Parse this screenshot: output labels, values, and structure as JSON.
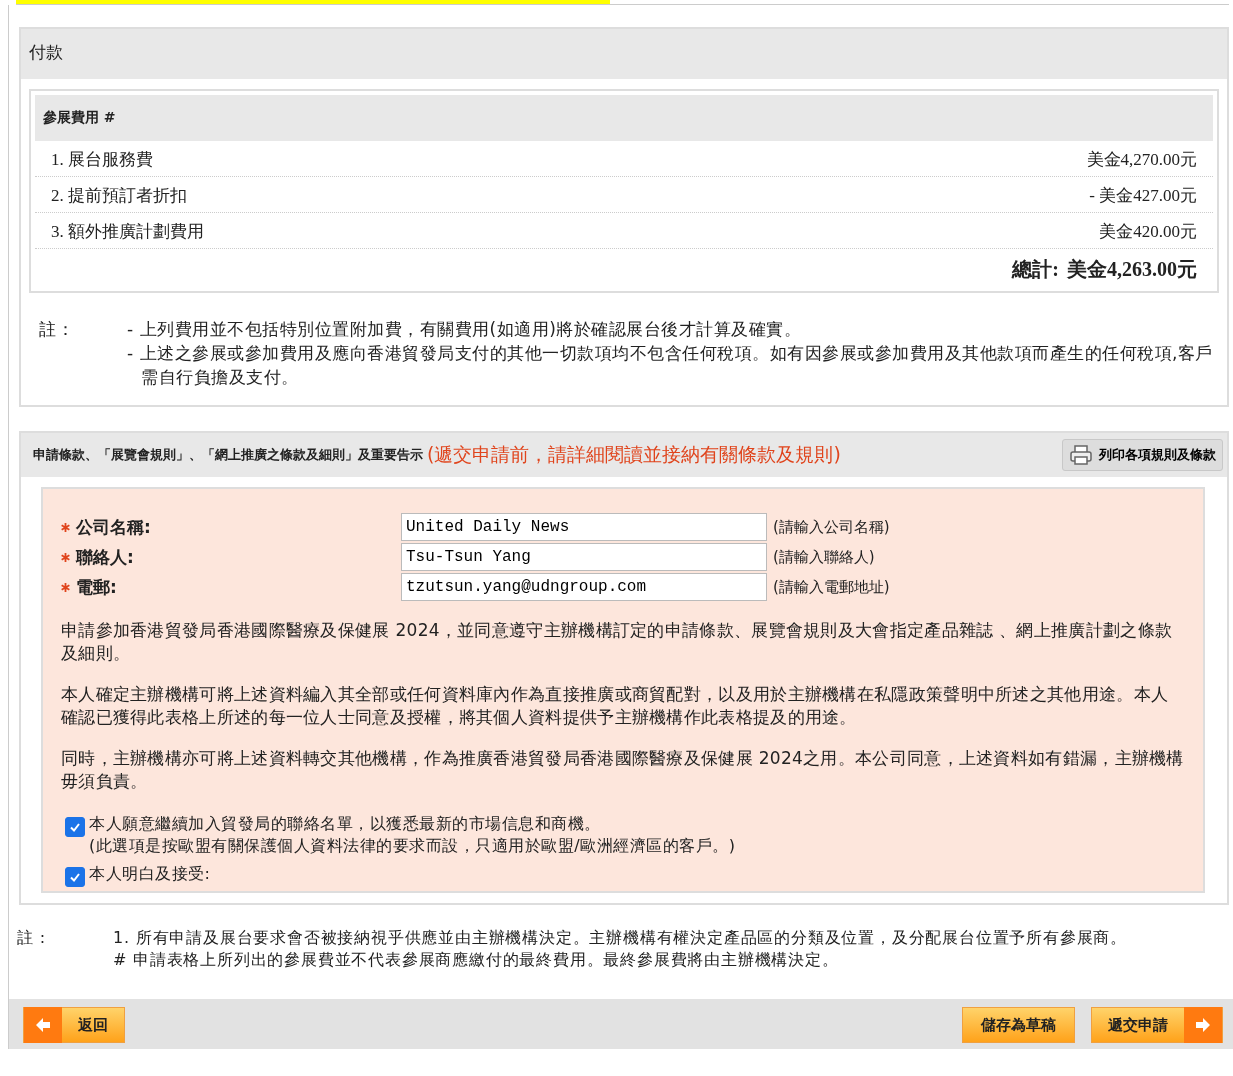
{
  "progress_bar": {
    "level": 0.49
  },
  "payment": {
    "title": "付款",
    "fees": {
      "heading": "參展費用 #",
      "items": [
        {
          "label": "1. 展台服務費",
          "amount": "美金4,270.00元"
        },
        {
          "label": "2. 提前預訂者折扣",
          "amount": "- 美金427.00元"
        },
        {
          "label": "3. 額外推廣計劃費用",
          "amount": "美金420.00元"
        }
      ],
      "total_label": "總計:",
      "total": "美金4,263.00元"
    },
    "note_label": "註：",
    "notes": [
      "- 上列費用並不包括特別位置附加費，有關費用(如適用)將於確認展台後才計算及確實。",
      "- 上述之參展或參加費用及應向香港貿發局支付的其他一切款項均不包含任何稅項。如有因參展或參加費用及其他款項而產生的任何稅項,客戶需自行負擔及支付。"
    ]
  },
  "terms": {
    "heading": "申請條款、「展覽會規則」、「網上推廣之條款及細則」及重要告示",
    "warning": "(遞交申請前，請詳細閱讀並接納有關條款及規則)",
    "print_button": "列印各項規則及條款",
    "fields": [
      {
        "label": "公司名稱:",
        "required": true,
        "value": "United Daily News",
        "hint": "(請輸入公司名稱)"
      },
      {
        "label": "聯絡人:",
        "required": true,
        "value": "Tsu-Tsun Yang",
        "hint": "(請輸入聯絡人)"
      },
      {
        "label": "電郵:",
        "required": true,
        "value": "tzutsun.yang@udngroup.com",
        "hint": "(請輸入電郵地址)"
      }
    ],
    "paragraphs": [
      "申請參加香港貿發局香港國際醫療及保健展 2024，並同意遵守主辦機構訂定的申請條款、展覽會規則及大會指定產品雜誌 、網上推廣計劃之條款及細則。",
      "本人確定主辦機構可將上述資料編入其全部或任何資料庫內作為直接推廣或商貿配對，以及用於主辦機構在私隱政策聲明中所述之其他用途。本人確認已獲得此表格上所述的每一位人士同意及授權，將其個人資料提供予主辦機構作此表格提及的用途。",
      "同時，主辦機構亦可將上述資料轉交其他機構，作為推廣香港貿發局香港國際醫療及保健展 2024之用。本公司同意，上述資料如有錯漏，主辦機構毋須負責。"
    ],
    "checkboxes": [
      {
        "label": "本人願意繼續加入貿發局的聯絡名單，以獲悉最新的市場信息和商機。",
        "sublabel": "(此選項是按歐盟有關保護個人資料法律的要求而設，只適用於歐盟/歐洲經濟區的客戶。)",
        "checked": true
      },
      {
        "label": "本人明白及接受:",
        "checked": true
      }
    ]
  },
  "footer_notes": {
    "label": "註 :",
    "items": [
      "1. 所有申請及展台要求會否被接納視乎供應並由主辦機構決定。主辦機構有權決定產品區的分類及位置，及分配展台位置予所有參展商。",
      "# 申請表格上所列出的參展費並不代表參展商應繳付的最終費用。最終參展費將由主辦機構決定。"
    ]
  },
  "buttons": [
    {
      "label": "返回",
      "kind": "back"
    },
    {
      "label": "儲存為草稿",
      "kind": "plain"
    },
    {
      "label": "遞交申請",
      "kind": "next"
    }
  ]
}
